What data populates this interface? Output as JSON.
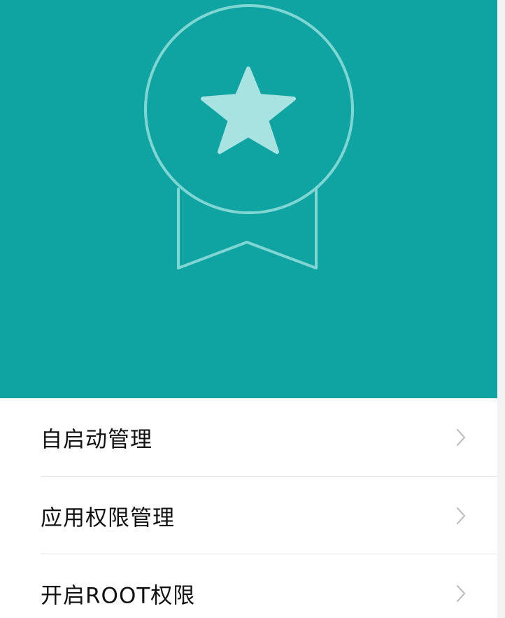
{
  "hero": {
    "background_color": "#0fa3a2",
    "icon": "medal-star-icon",
    "icon_line_color": "#7fd6d3",
    "star_color": "#a9e3e1"
  },
  "menu": {
    "items": [
      {
        "label": "自启动管理",
        "icon": "chevron-right-icon"
      },
      {
        "label": "应用权限管理",
        "icon": "chevron-right-icon"
      },
      {
        "label": "开启ROOT权限",
        "icon": "chevron-right-icon"
      }
    ]
  }
}
